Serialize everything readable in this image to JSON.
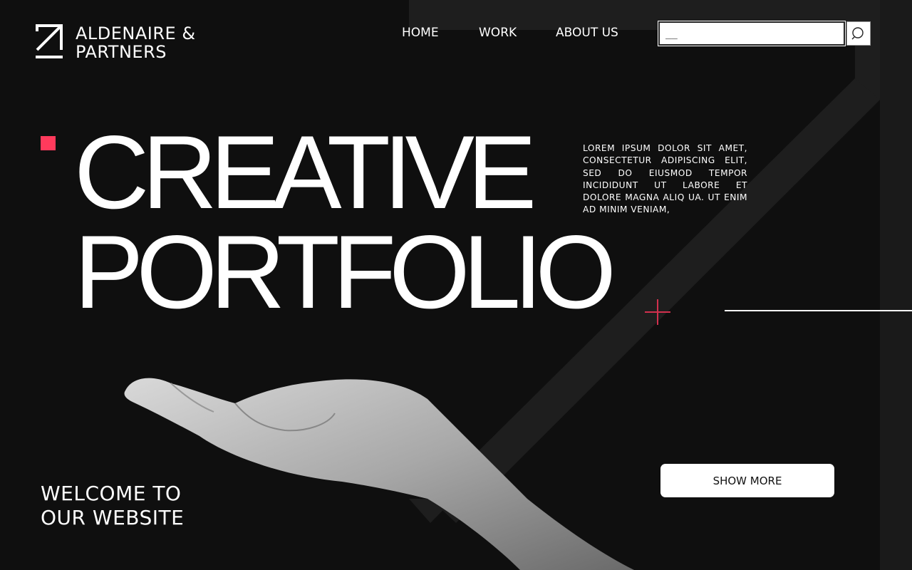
{
  "brand": {
    "name_line1": "ALDENAIRE &",
    "name_line2": "PARTNERS",
    "logo_icon": "arrow-up-right-logo"
  },
  "nav": {
    "items": [
      {
        "label": "HOME"
      },
      {
        "label": "WORK"
      },
      {
        "label": "ABOUT US"
      }
    ]
  },
  "search": {
    "value": "__",
    "placeholder": "",
    "icon": "search-icon"
  },
  "hero": {
    "title_line1": "CREATIVE",
    "title_line2": "PORTFOLIO"
  },
  "intro_text": "LOREM IPSUM DOLOR SIT AMET, CONSECTETUR ADIPISCING ELIT, SED DO EIUSMOD TEMPOR INCIDIDUNT UT LABORE ET DOLORE MAGNA ALIQ UA. UT ENIM AD MINIM VENIAM,",
  "welcome": {
    "line1": "WELCOME TO",
    "line2": "OUR WEBSITE"
  },
  "cta": {
    "label": "SHOW MORE"
  },
  "colors": {
    "background": "#0f0f0f",
    "accent": "#ff3a5c",
    "text": "#ffffff",
    "shape": "#1e1e1e"
  }
}
